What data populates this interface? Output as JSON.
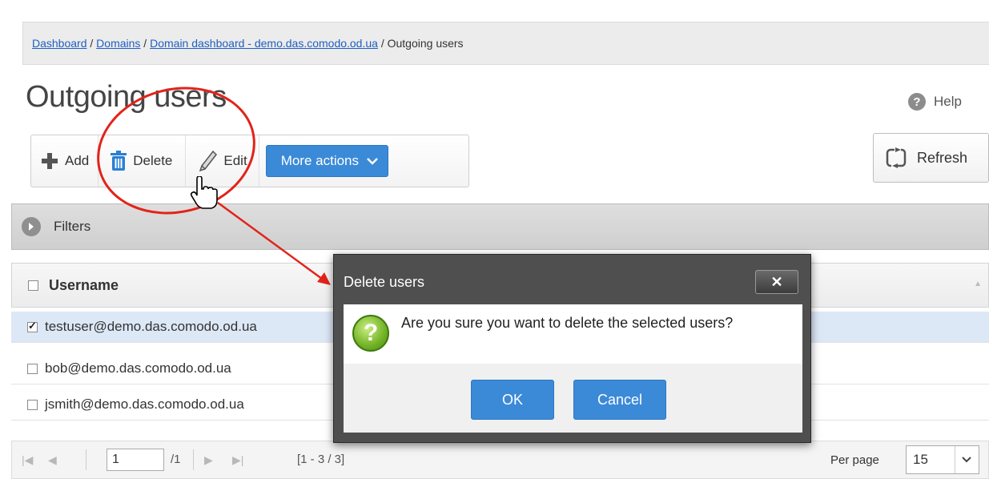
{
  "breadcrumb": {
    "items": [
      "Dashboard",
      "Domains",
      "Domain dashboard - demo.das.comodo.od.ua"
    ],
    "separator": " / ",
    "current": "Outgoing users"
  },
  "page": {
    "title": "Outgoing users",
    "help_label": "Help",
    "help_glyph": "?"
  },
  "toolbar": {
    "add_label": "Add",
    "delete_label": "Delete",
    "edit_label": "Edit",
    "more_actions_label": "More actions",
    "refresh_label": "Refresh"
  },
  "filters": {
    "label": "Filters"
  },
  "table": {
    "column_username": "Username",
    "rows": [
      {
        "username": "testuser@demo.das.comodo.od.ua",
        "checked": true
      },
      {
        "username": "bob@demo.das.comodo.od.ua",
        "checked": false
      },
      {
        "username": "jsmith@demo.das.comodo.od.ua",
        "checked": false
      }
    ]
  },
  "pager": {
    "page_value": "1",
    "total_pages": "/1",
    "range": "[1 - 3 / 3]",
    "per_page_label": "Per page",
    "per_page_value": "15"
  },
  "dialog": {
    "title": "Delete users",
    "close_glyph": "✕",
    "question_glyph": "?",
    "message": "Are you sure you want to delete the selected users?",
    "ok_label": "OK",
    "cancel_label": "Cancel"
  },
  "colors": {
    "accent": "#3b8ad8",
    "annotation": "#e2231a",
    "link": "#1f5fbf"
  }
}
